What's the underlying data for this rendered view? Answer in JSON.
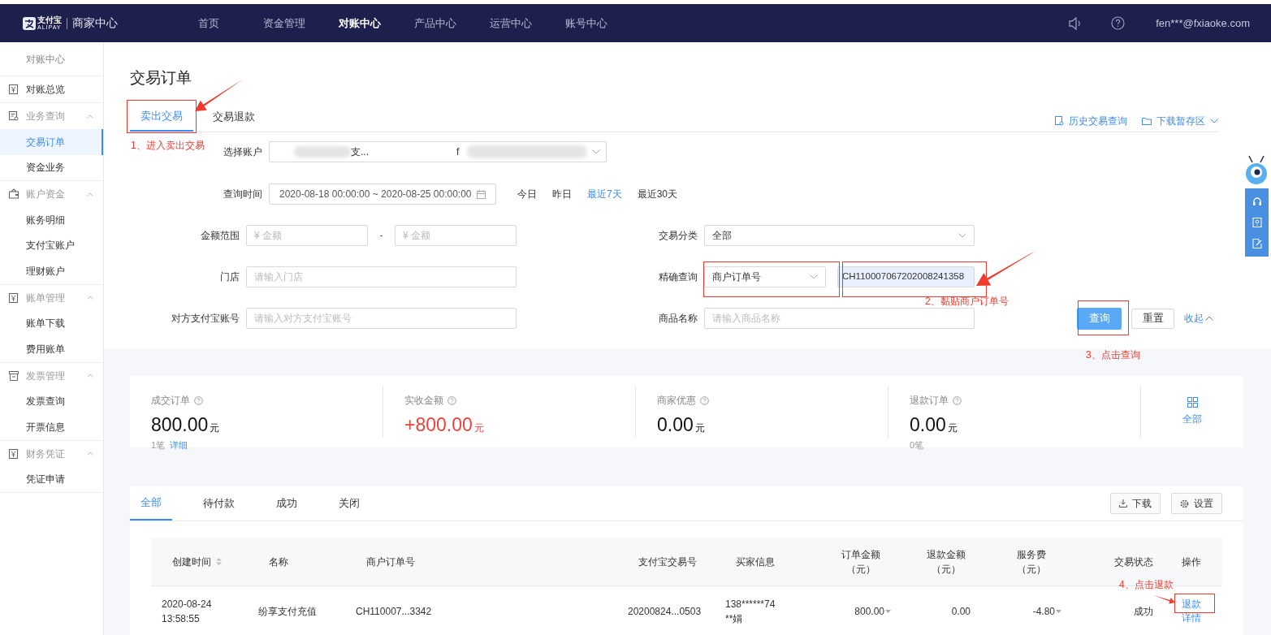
{
  "top_nav": {
    "logo": {
      "mark": "支付宝",
      "sub": "ALIPAY",
      "product": "商家中心"
    },
    "items": [
      {
        "label": "首页",
        "selected": false
      },
      {
        "label": "资金管理",
        "selected": false
      },
      {
        "label": "对账中心",
        "selected": true
      },
      {
        "label": "产品中心",
        "selected": false
      },
      {
        "label": "运营中心",
        "selected": false
      },
      {
        "label": "账号中心",
        "selected": false
      }
    ],
    "user": "fen***@fxiaoke.com"
  },
  "sidebar": {
    "title": "对账中心",
    "sections": [
      {
        "label": "对账总览",
        "kind": "link"
      },
      {
        "label": "业务查询",
        "kind": "group",
        "expanded": true,
        "children": [
          {
            "label": "交易订单",
            "selected": true
          },
          {
            "label": "资金业务",
            "selected": false
          }
        ]
      },
      {
        "label": "账户资金",
        "kind": "group",
        "expanded": true,
        "children": [
          {
            "label": "账务明细",
            "selected": false
          },
          {
            "label": "支付宝账户",
            "selected": false
          },
          {
            "label": "理财账户",
            "selected": false
          }
        ]
      },
      {
        "label": "账单管理",
        "kind": "group",
        "expanded": true,
        "children": [
          {
            "label": "账单下载",
            "selected": false
          },
          {
            "label": "费用账单",
            "selected": false
          }
        ]
      },
      {
        "label": "发票管理",
        "kind": "group",
        "expanded": true,
        "children": [
          {
            "label": "发票查询",
            "selected": false
          },
          {
            "label": "开票信息",
            "selected": false
          }
        ]
      },
      {
        "label": "财务凭证",
        "kind": "group",
        "expanded": true,
        "children": [
          {
            "label": "凭证申请",
            "selected": false
          }
        ]
      }
    ]
  },
  "page": {
    "title": "交易订单",
    "tabs": [
      {
        "label": "卖出交易",
        "selected": true
      },
      {
        "label": "交易退款",
        "selected": false
      }
    ],
    "links": [
      {
        "label": "历史交易查询",
        "kind": "history"
      },
      {
        "label": "下载暂存区",
        "kind": "folder"
      }
    ],
    "form": {
      "account": {
        "label": "选择账户",
        "fragments": [
          "支...",
          "f"
        ]
      },
      "time": {
        "label": "查询时间",
        "value": "2020-08-18 00:00:00 ~ 2020-08-25 00:00:00",
        "quick": [
          {
            "label": "今日",
            "selected": false
          },
          {
            "label": "昨日",
            "selected": false
          },
          {
            "label": "最近7天",
            "selected": true
          },
          {
            "label": "最近30天",
            "selected": false
          }
        ]
      },
      "rows": [
        {
          "left": {
            "label": "金额范围",
            "kind": "range",
            "placeholders": [
              "¥ 金额",
              "¥ 金额"
            ],
            "separator": "-"
          },
          "right": {
            "label": "交易分类",
            "kind": "select",
            "value": "全部"
          }
        },
        {
          "left": {
            "label": "门店",
            "kind": "input",
            "placeholder": "请输入门店"
          },
          "right": {
            "label": "精确查询",
            "kind": "select-input",
            "value": "商户订单号",
            "input_value": "CH110007067202008241358"
          }
        },
        {
          "left": {
            "label": "对方支付宝账号",
            "kind": "input",
            "placeholder": "请输入对方支付宝账号"
          },
          "right": {
            "label": "商品名称",
            "kind": "input",
            "placeholder": "请输入商品名称"
          }
        }
      ],
      "buttons": [
        {
          "label": "查询",
          "kind": "primary"
        },
        {
          "label": "重置",
          "kind": "default"
        },
        {
          "label": "收起",
          "kind": "link"
        }
      ]
    }
  },
  "stats": [
    {
      "label": "成交订单",
      "value": "800.00",
      "unit": "元",
      "highlight": false,
      "note": "1笔",
      "link": "详细"
    },
    {
      "label": "实收金额",
      "value": "+800.00",
      "unit": "元",
      "highlight": true
    },
    {
      "label": "商家优惠",
      "value": "0.00",
      "unit": "元",
      "highlight": false
    },
    {
      "label": "退款订单",
      "value": "0.00",
      "unit": "元",
      "highlight": false,
      "note": "0笔"
    }
  ],
  "stats_all": "全部",
  "orders": {
    "tabs": [
      {
        "label": "全部",
        "selected": true
      },
      {
        "label": "待付款",
        "selected": false
      },
      {
        "label": "成功",
        "selected": false
      },
      {
        "label": "关闭",
        "selected": false
      }
    ],
    "buttons": [
      {
        "label": "下载"
      },
      {
        "label": "设置"
      }
    ],
    "columns": [
      {
        "label": "创建时间",
        "sortable": true
      },
      {
        "label": "名称"
      },
      {
        "label": "商户订单号"
      },
      {
        "label": "支付宝交易号"
      },
      {
        "label": "买家信息"
      },
      {
        "label": "订单金额（元）"
      },
      {
        "label": "退款金额（元）"
      },
      {
        "label": "服务费（元）"
      },
      {
        "label": "交易状态"
      },
      {
        "label": "操作"
      }
    ],
    "rows": [
      {
        "created": [
          "2020-08-24",
          "13:58:55"
        ],
        "name": "纷享支付充值",
        "merchant_order": "CH110007...3342",
        "trade_no": "20200824...0503",
        "buyer": [
          "138******74",
          "**娟"
        ],
        "amount": "800.00",
        "refund": "0.00",
        "fee": "-4.80",
        "status": "成功",
        "actions": [
          "退款",
          "详情"
        ]
      }
    ]
  },
  "annotations": [
    {
      "text": "1、进入卖出交易"
    },
    {
      "text": "2、黏贴商户订单号"
    },
    {
      "text": "3、点击查询"
    },
    {
      "text": "4、点击退款"
    }
  ]
}
